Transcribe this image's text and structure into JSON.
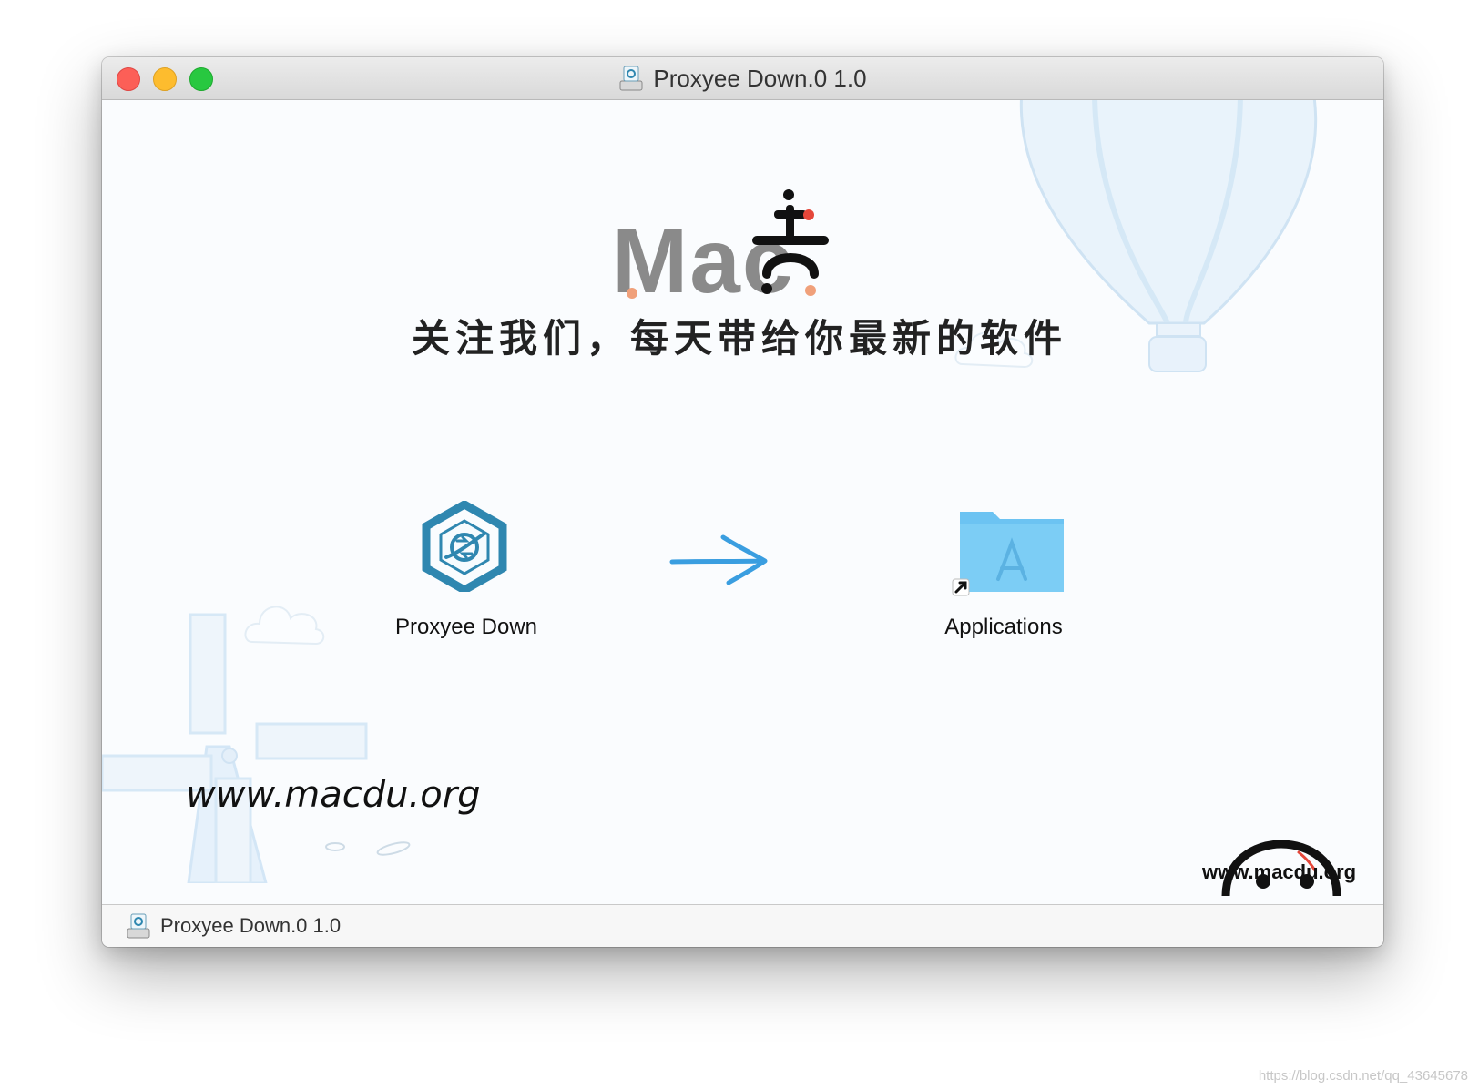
{
  "window": {
    "title": "Proxyee Down.0 1.0",
    "buttons": {
      "close": "close",
      "minimize": "minimize",
      "maximize": "zoom"
    }
  },
  "branding": {
    "mac_text": "Mac",
    "tagline": "关注我们，每天带给你最新的软件",
    "site_left": "www.macdu.org",
    "site_right": "www.macdu.org"
  },
  "items": {
    "app_label": "Proxyee Down",
    "folder_label": "Applications"
  },
  "statusbar": {
    "text": "Proxyee Down.0 1.0"
  },
  "page_watermark": "https://blog.csdn.net/qq_43645678",
  "colors": {
    "app_icon": "#2f87b0",
    "arrow": "#3a9ee0",
    "folder": "#6cc3f2",
    "accent_red": "#e5473a",
    "accent_orange": "#f0a07a"
  }
}
